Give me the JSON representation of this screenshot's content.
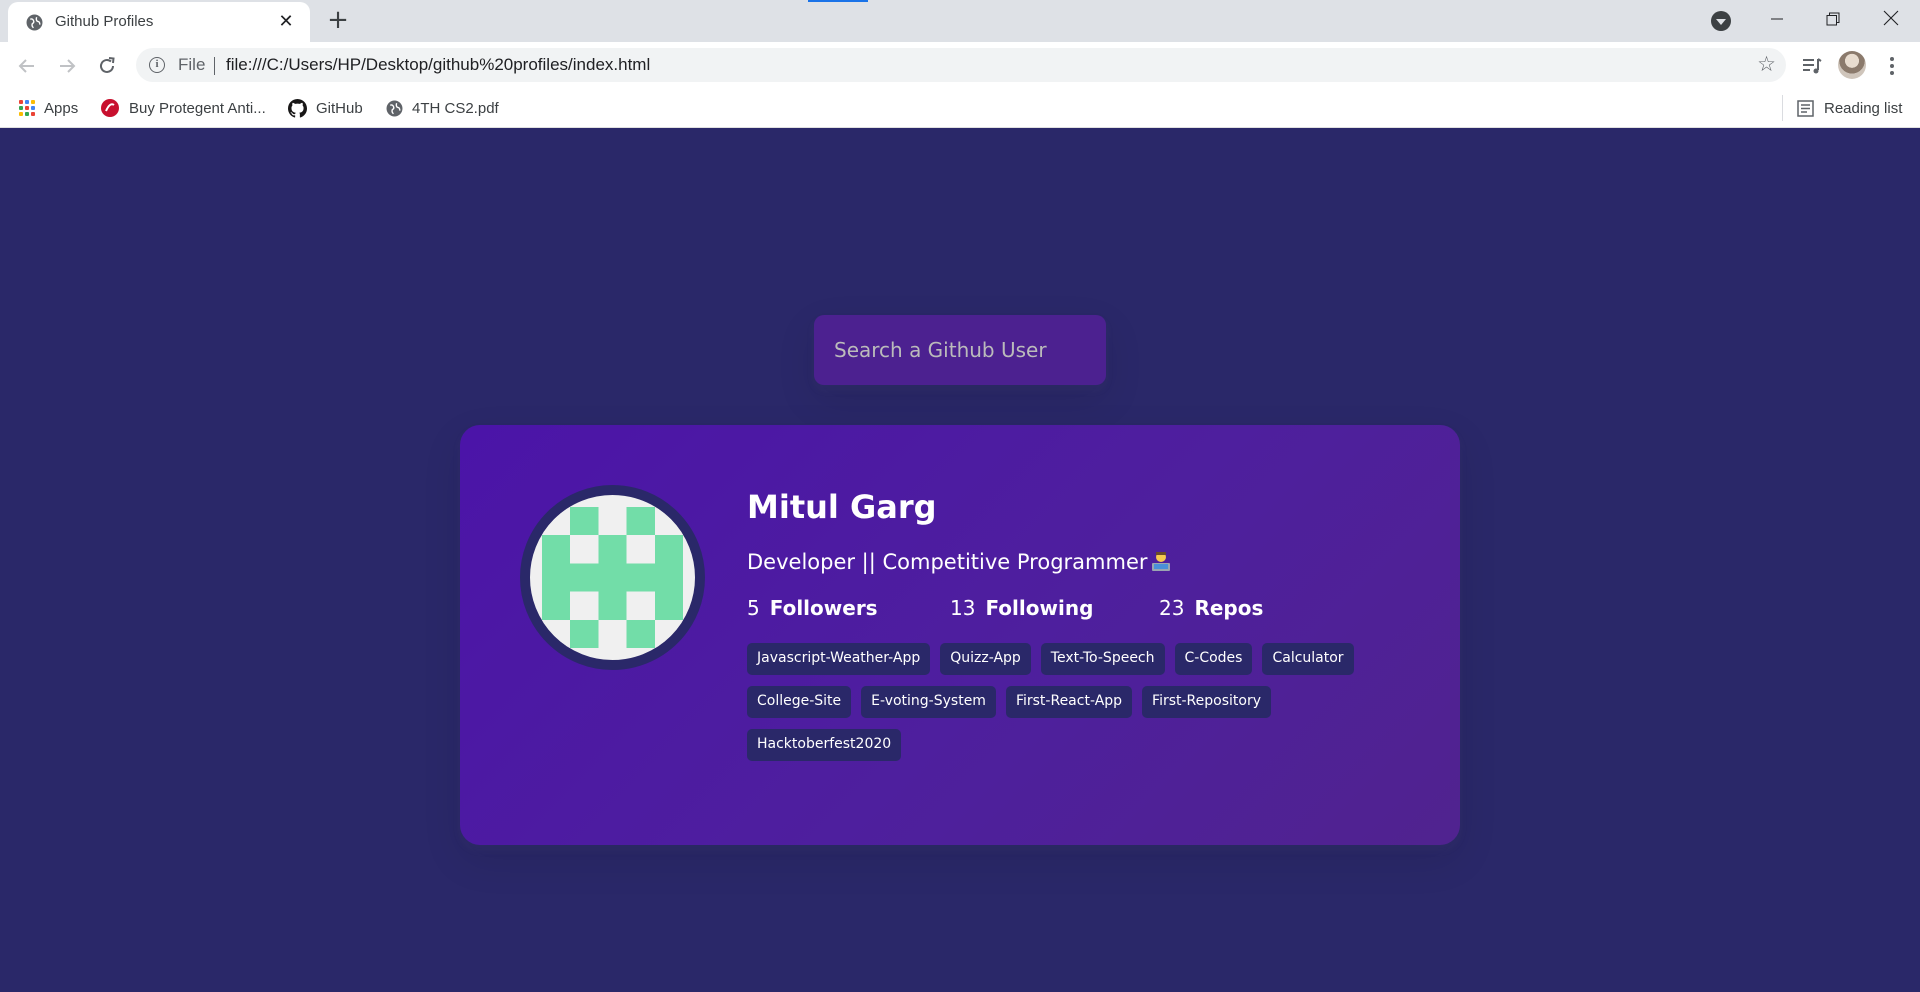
{
  "browser": {
    "tab_title": "Github Profiles",
    "tab_close": "✕",
    "new_tab": "+",
    "url_scheme": "File",
    "url": "file:///C:/Users/HP/Desktop/github%20profiles/index.html",
    "bookmarks": [
      {
        "label": "Apps",
        "icon": "apps-grid-icon"
      },
      {
        "label": "Buy Protegent Anti...",
        "icon": "protegent-icon"
      },
      {
        "label": "GitHub",
        "icon": "github-icon"
      },
      {
        "label": "4TH CS2.pdf",
        "icon": "globe-icon"
      }
    ],
    "reading_list": "Reading list"
  },
  "search": {
    "placeholder": "Search a Github User"
  },
  "profile": {
    "name": "Mitul Garg",
    "bio": "Developer || Competitive Programmer",
    "followers": {
      "count": "5",
      "label": "Followers"
    },
    "following": {
      "count": "13",
      "label": "Following"
    },
    "repos_stat": {
      "count": "23",
      "label": "Repos"
    },
    "repos": [
      "Javascript-Weather-App",
      "Quizz-App",
      "Text-To-Speech",
      "C-Codes",
      "Calculator",
      "College-Site",
      "E-voting-System",
      "First-React-App",
      "First-Repository",
      "Hacktoberfest2020"
    ]
  },
  "colors": {
    "page_bg": "#2a2869",
    "card_bg": "#4b14a8",
    "search_bg": "#4c2190",
    "identicon": "#72dda8",
    "identicon_bg": "#f0f0f0"
  }
}
